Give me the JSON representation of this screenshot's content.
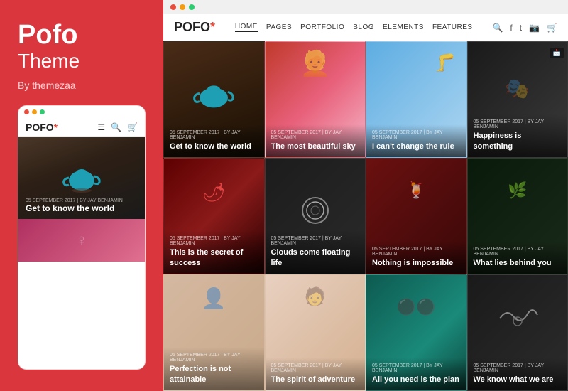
{
  "left": {
    "brand": "Pofo",
    "theme": "Theme",
    "by": "By themezaa",
    "mobile": {
      "logo": "POFO",
      "logo_star": "*",
      "hero_date": "05 SEPTEMBER 2017",
      "hero_by": "BY JAY BENJAMIN",
      "hero_title": "Get to know the world"
    }
  },
  "browser": {
    "site_logo": "POFO",
    "site_logo_star": "*",
    "nav": [
      "HOME",
      "PAGES",
      "PORTFOLIO",
      "BLOG",
      "ELEMENTS",
      "FEATURES"
    ],
    "grid_items": [
      {
        "id": 1,
        "date": "05 SEPTEMBER 2017",
        "by": "BY JAY BENJAMIN",
        "title": "Get to know the world",
        "bg": "teapot"
      },
      {
        "id": 2,
        "date": "05 SEPTEMBER 2017",
        "by": "BY JAY BENJAMIN",
        "title": "The most beautiful sky",
        "bg": "pink"
      },
      {
        "id": 3,
        "date": "05 SEPTEMBER 2017",
        "by": "BY JAY BENJAMIN",
        "title": "I can't change the rule",
        "bg": "blue"
      },
      {
        "id": 4,
        "date": "05 SEPTEMBER 2017",
        "by": "BY JAY BENJAMIN",
        "title": "Happiness is something",
        "bg": "striped"
      },
      {
        "id": 5,
        "date": "05 SEPTEMBER 2017",
        "by": "BY JAY BENJAMIN",
        "title": "This is the secret of success",
        "bg": "pepper"
      },
      {
        "id": 6,
        "date": "05 SEPTEMBER 2017",
        "by": "BY JAY BENJAMIN",
        "title": "Clouds come floating life",
        "bg": "rings"
      },
      {
        "id": 7,
        "date": "05 SEPTEMBER 2017",
        "by": "BY JAY BENJAMIN",
        "title": "Nothing is impossible",
        "bg": "cocktail"
      },
      {
        "id": 8,
        "date": "05 SEPTEMBER 2017",
        "by": "BY JAY BENJAMIN",
        "title": "What lies behind you",
        "bg": "green"
      },
      {
        "id": 9,
        "date": "05 SEPTEMBER 2017",
        "by": "BY JAY BENJAMIN",
        "title": "Perfection is not attainable",
        "bg": "face"
      },
      {
        "id": 10,
        "date": "05 SEPTEMBER 2017",
        "by": "BY JAY BENJAMIN",
        "title": "The spirit of adventure",
        "bg": "face2"
      },
      {
        "id": 11,
        "date": "05 SEPTEMBER 2017",
        "by": "BY JAY BENJAMIN",
        "title": "All you need is the plan",
        "bg": "teal"
      },
      {
        "id": 12,
        "date": "05 SEPTEMBER 2017",
        "by": "BY JAY BENJAMIN",
        "title": "We know what we are",
        "bg": "wire"
      }
    ]
  },
  "colors": {
    "red": "#d9363e",
    "accent": "#e74c3c"
  }
}
